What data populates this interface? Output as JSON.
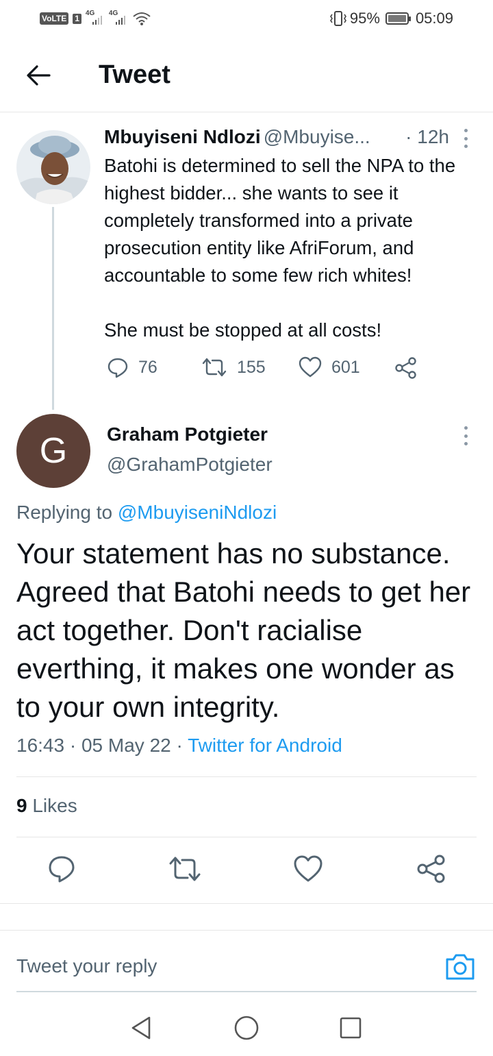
{
  "status_bar": {
    "volte": "VoLTE",
    "sim": "1",
    "network1": "4G",
    "network2": "4G",
    "battery": "95%",
    "time": "05:09",
    "icons": [
      "wifi-icon",
      "vibrate-icon",
      "battery-icon"
    ]
  },
  "header": {
    "title": "Tweet",
    "back_icon": "arrow-left-icon"
  },
  "parent_tweet": {
    "name": "Mbuyiseni Ndlozi",
    "handle": "@Mbuyise...",
    "time": "· 12h",
    "text": "Batohi is determined to sell the NPA to the highest bidder... she wants to see it completely transformed into a private prosecution entity like AfriForum, and accountable to some few rich whites!\n\nShe must be stopped at all costs!",
    "replies": "76",
    "retweets": "155",
    "likes": "601"
  },
  "reply_tweet": {
    "avatar_letter": "G",
    "avatar_color": "#5d4037",
    "name": "Graham Potgieter",
    "handle": "@GrahamPotgieter",
    "replying_prefix": "Replying to ",
    "replying_handle": "@MbuyiseniNdlozi",
    "text": "Your statement has no substance. Agreed that Batohi needs to get her act together. Don't racialise everthing, it makes one wonder as to your own integrity.",
    "time": "16:43",
    "sep": " · ",
    "date": "05 May 22",
    "source": "Twitter for Android",
    "likes_count": "9",
    "likes_label": " Likes"
  },
  "reply_box": {
    "placeholder": "Tweet your reply"
  },
  "colors": {
    "accent": "#1d9bf0",
    "secondary_text": "#536471"
  }
}
